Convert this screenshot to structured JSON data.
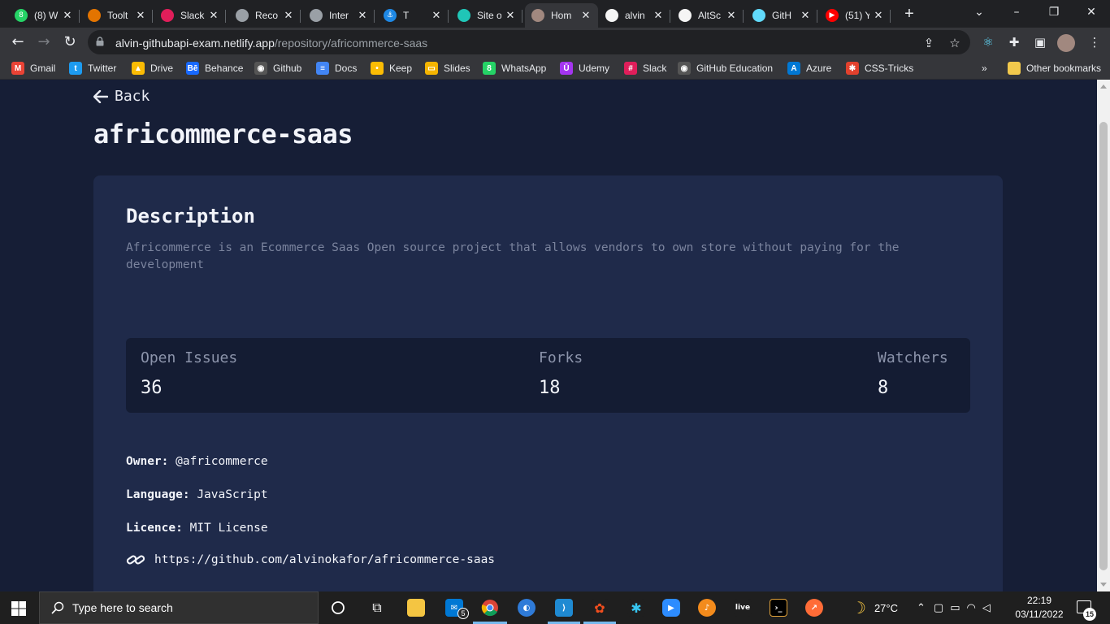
{
  "browser": {
    "tabs": [
      {
        "title": "(8) W",
        "icon": "whatsapp-icon",
        "color": "#25d366",
        "glyph": "8"
      },
      {
        "title": "Toolt",
        "icon": "tooltip-icon",
        "color": "#e37400",
        "glyph": ""
      },
      {
        "title": "Slack",
        "icon": "slack-icon",
        "color": "#e01e5a",
        "glyph": ""
      },
      {
        "title": "Reco",
        "icon": "globe-icon",
        "color": "#9aa0a6",
        "glyph": ""
      },
      {
        "title": "Inter",
        "icon": "globe-icon",
        "color": "#9aa0a6",
        "glyph": ""
      },
      {
        "title": "T",
        "icon": "anchor-icon",
        "color": "#1e88e5",
        "glyph": "⚓"
      },
      {
        "title": "Site o",
        "icon": "netlify-icon",
        "color": "#20c6b7",
        "glyph": ""
      },
      {
        "title": "Hom",
        "icon": "avatar-icon",
        "color": "#a1887f",
        "glyph": ""
      },
      {
        "title": "alvin",
        "icon": "github-icon",
        "color": "#f5f5f5",
        "glyph": ""
      },
      {
        "title": "AltSc",
        "icon": "github-icon",
        "color": "#f5f5f5",
        "glyph": ""
      },
      {
        "title": "GitH",
        "icon": "react-icon",
        "color": "#61dafb",
        "glyph": ""
      },
      {
        "title": "(51) Y",
        "icon": "youtube-icon",
        "color": "#ff0000",
        "glyph": "▶"
      }
    ],
    "url_domain": "alvin-githubapi-exam.netlify.app",
    "url_path": "/repository/africommerce-saas",
    "bookmarks": [
      {
        "label": "Gmail",
        "icon": "gmail-icon",
        "color": "#ea4335",
        "glyph": "M"
      },
      {
        "label": "Twitter",
        "icon": "twitter-icon",
        "color": "#1d9bf0",
        "glyph": "t"
      },
      {
        "label": "Drive",
        "icon": "drive-icon",
        "color": "#fbbc04",
        "glyph": "▲"
      },
      {
        "label": "Behance",
        "icon": "behance-icon",
        "color": "#1769ff",
        "glyph": "Bē"
      },
      {
        "label": "Github",
        "icon": "github-icon",
        "color": "#555555",
        "glyph": "◉"
      },
      {
        "label": "Docs",
        "icon": "docs-icon",
        "color": "#4285f4",
        "glyph": "≡"
      },
      {
        "label": "Keep",
        "icon": "keep-icon",
        "color": "#fbbc04",
        "glyph": "•"
      },
      {
        "label": "Slides",
        "icon": "slides-icon",
        "color": "#f4b400",
        "glyph": "▭"
      },
      {
        "label": "WhatsApp",
        "icon": "whatsapp-icon",
        "color": "#25d366",
        "glyph": "8"
      },
      {
        "label": "Udemy",
        "icon": "udemy-icon",
        "color": "#a435f0",
        "glyph": "Ū"
      },
      {
        "label": "Slack",
        "icon": "slack-icon",
        "color": "#e01e5a",
        "glyph": "#"
      },
      {
        "label": "GitHub Education",
        "icon": "github-icon",
        "color": "#555555",
        "glyph": "◉"
      },
      {
        "label": "Azure",
        "icon": "azure-icon",
        "color": "#0078d4",
        "glyph": "A"
      },
      {
        "label": "CSS-Tricks",
        "icon": "css-tricks-icon",
        "color": "#e2412d",
        "glyph": "✱"
      }
    ],
    "overflow": "»",
    "other_bookmarks": "Other bookmarks"
  },
  "page": {
    "back_label": "Back",
    "repo_name": "africommerce-saas",
    "description_heading": "Description",
    "description": "Africommerce is an Ecommerce Saas Open source project that allows vendors to own store without paying for the development",
    "stats": {
      "issues_label": "Open Issues",
      "issues_value": "36",
      "forks_label": "Forks",
      "forks_value": "18",
      "watchers_label": "Watchers",
      "watchers_value": "8"
    },
    "owner_label": "Owner:",
    "owner_value": "@africommerce",
    "language_label": "Language:",
    "language_value": "JavaScript",
    "licence_label": "Licence:",
    "licence_value": "MIT License",
    "repo_url": "https://github.com/alvinokafor/africommerce-saas"
  },
  "taskbar": {
    "search_placeholder": "Type here to search",
    "mail_badge": "5",
    "live_label": "live",
    "weather": "27°C",
    "time": "22:19",
    "date": "03/11/2022",
    "notification_count": "15"
  },
  "colors": {
    "page_bg": "#161e36",
    "card_bg": "#1f2a4a",
    "stats_bg": "#141c33",
    "muted_text": "#7b849e"
  }
}
